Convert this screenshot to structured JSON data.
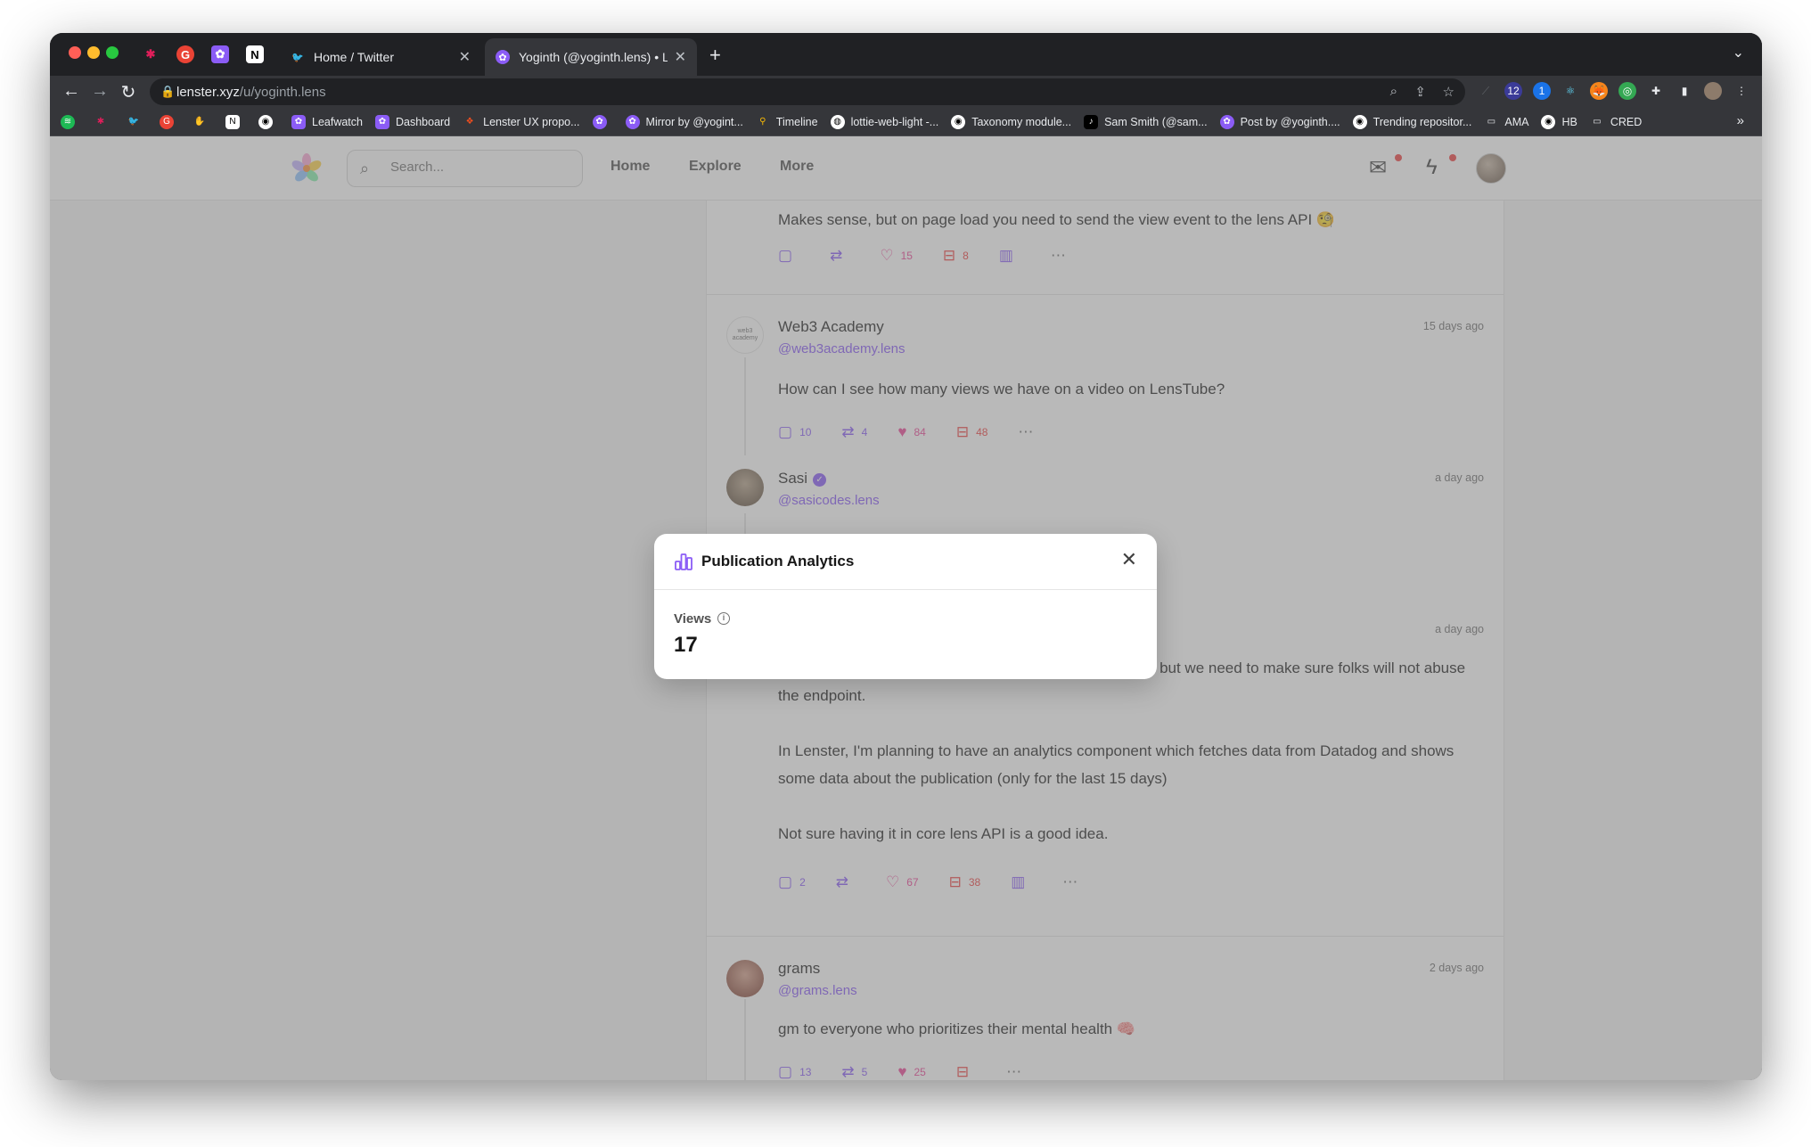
{
  "browser": {
    "tabs": [
      {
        "title": "Home / Twitter",
        "active": false
      },
      {
        "title": "Yoginth (@yoginth.lens) • Lens",
        "active": true
      }
    ],
    "url_host": "lenster.xyz",
    "url_path": "/u/yoginth.lens",
    "bookmarks": [
      {
        "label": "",
        "icon": "spotify-icon",
        "color": "#1db954"
      },
      {
        "label": "",
        "icon": "slack-icon",
        "color": "#e01e5a"
      },
      {
        "label": "",
        "icon": "twitter-icon",
        "color": "#1d9bf0"
      },
      {
        "label": "",
        "icon": "chrome-app-icon",
        "color": "#ea4335"
      },
      {
        "label": "",
        "icon": "hand-icon",
        "color": "#8ab4f8"
      },
      {
        "label": "",
        "icon": "notion-icon",
        "color": "#202124"
      },
      {
        "label": "",
        "icon": "github-icon",
        "color": "#202124"
      },
      {
        "label": "Leafwatch",
        "icon": "lens-icon",
        "color": "#8b5cf6"
      },
      {
        "label": "Dashboard",
        "icon": "lens-icon",
        "color": "#8b5cf6"
      },
      {
        "label": "Lenster UX propo...",
        "icon": "figma-icon",
        "color": "#f24e1e"
      },
      {
        "label": "",
        "icon": "lens-icon",
        "color": "#8b5cf6"
      },
      {
        "label": "Mirror by @yogint...",
        "icon": "lens-icon",
        "color": "#8b5cf6"
      },
      {
        "label": "Timeline",
        "icon": "map-pin-icon",
        "color": "#fbbc04"
      },
      {
        "label": "lottie-web-light -...",
        "icon": "globe-icon",
        "color": "#5f6368"
      },
      {
        "label": "Taxonomy module...",
        "icon": "github-icon",
        "color": "#202124"
      },
      {
        "label": "Sam Smith (@sam...",
        "icon": "tiktok-icon",
        "color": "#000000"
      },
      {
        "label": "Post by @yoginth....",
        "icon": "lens-icon",
        "color": "#8b5cf6"
      },
      {
        "label": "Trending repositor...",
        "icon": "github-icon",
        "color": "#202124"
      },
      {
        "label": "AMA",
        "icon": "folder-icon",
        "color": "#9aa0a6"
      },
      {
        "label": "HB",
        "icon": "github-icon",
        "color": "#202124"
      },
      {
        "label": "CRED",
        "icon": "folder-icon",
        "color": "#9aa0a6"
      }
    ]
  },
  "header": {
    "search_placeholder": "Search...",
    "nav": [
      "Home",
      "Explore",
      "More"
    ]
  },
  "feed": {
    "post0": {
      "text": "Makes sense, but on page load you need to send the view event to the lens API 🧐",
      "stats": {
        "comments": "",
        "mirrors": "",
        "likes": "15",
        "collects": "8"
      }
    },
    "post1": {
      "name": "Web3 Academy",
      "handle": "@web3academy.lens",
      "time": "15 days ago",
      "avatar_text": "web3 academy",
      "text": "How can I see how many views we have on a video on LensTube?",
      "stats": {
        "comments": "10",
        "mirrors": "4",
        "likes": "84",
        "collects": "48"
      }
    },
    "post2": {
      "name": "Sasi",
      "handle": "@sasicodes.lens",
      "time": "a day ago"
    },
    "post3": {
      "time": "a day ago",
      "paragraphs": [
        "I think we can achieve this by having a custom backend, but we need to make sure folks will not abuse the endpoint.",
        "In Lenster, I'm planning to have an analytics component which fetches data from Datadog and shows some data about the publication (only for the last 15 days)",
        "Not sure having it in core lens API is a good idea."
      ],
      "stats": {
        "comments": "2",
        "mirrors": "",
        "likes": "67",
        "collects": "38"
      }
    },
    "post4": {
      "name": "grams",
      "handle": "@grams.lens",
      "time": "2 days ago",
      "text": "gm to everyone who prioritizes their mental health 🧠",
      "stats": {
        "comments": "13",
        "mirrors": "5",
        "likes": "25",
        "collects": ""
      }
    }
  },
  "modal": {
    "title": "Publication Analytics",
    "views_label": "Views",
    "views_value": "17"
  },
  "colors": {
    "accent": "#8b5cf6",
    "like": "#ec4899",
    "collect": "#ef4444",
    "notification_dot": "#ef4444"
  }
}
